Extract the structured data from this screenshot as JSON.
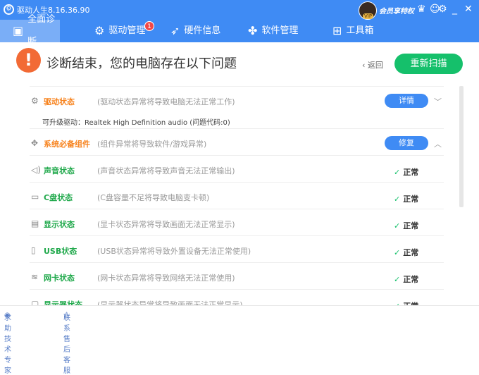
{
  "app": {
    "title": "驱动人生8.16.36.90",
    "member_label": "会员享特权",
    "vip_badge": "VIP"
  },
  "window_icons": [
    "crown-icon",
    "feedback-icon",
    "gear-icon",
    "minimize-icon",
    "close-icon"
  ],
  "tabs": [
    {
      "label": "全面诊断",
      "icon": "monitor-icon",
      "active": true
    },
    {
      "label": "驱动管理",
      "icon": "gear-icon",
      "badge": "1"
    },
    {
      "label": "硬件信息",
      "icon": "rocket-icon"
    },
    {
      "label": "软件管理",
      "icon": "clover-icon"
    },
    {
      "label": "工具箱",
      "icon": "toolbox-icon"
    }
  ],
  "header": {
    "title": "诊断结束，您的电脑存在以下问题",
    "back_label": "返回",
    "rescan_label": "重新扫描"
  },
  "colors": {
    "brand": "#3f8bf4",
    "warning": "#f26a35",
    "problem_text": "#f7831e",
    "ok_text": "#21a94c",
    "button_green": "#15c06b"
  },
  "rows": [
    {
      "name": "驱动状态",
      "desc": "(驱动状态异常将导致电脑无法正常工作)",
      "icon": "gear-icon",
      "status": "problem",
      "action": "详情",
      "expanded": false,
      "detail": "可升级驱动：Realtek High Definition audio (问题代码:0)"
    },
    {
      "name": "系统必备组件",
      "desc": "(组件异常将导致软件/游戏异常)",
      "icon": "puzzle-icon",
      "status": "problem",
      "action": "修复",
      "expanded": true
    },
    {
      "name": "声音状态",
      "desc": "(声音状态异常将导致声音无法正常输出)",
      "icon": "speaker-icon",
      "status": "正常"
    },
    {
      "name": "C盘状态",
      "desc": "(C盘容量不足将导致电脑变卡顿)",
      "icon": "disk-icon",
      "status": "正常"
    },
    {
      "name": "显示状态",
      "desc": "(显卡状态异常将导致画面无法正常显示)",
      "icon": "graphics-card-icon",
      "status": "正常"
    },
    {
      "name": "USB状态",
      "desc": "(USB状态异常将导致外置设备无法正常使用)",
      "icon": "usb-icon",
      "status": "正常"
    },
    {
      "name": "网卡状态",
      "desc": "(网卡状态异常将导致网络无法正常使用)",
      "icon": "wifi-icon",
      "status": "正常"
    },
    {
      "name": "显示器状态",
      "desc": "(显示器状态异常将导致画面无法正常显示)",
      "icon": "monitor-icon",
      "status": "正常"
    }
  ],
  "footer": {
    "expert": "求助技术专家",
    "service": "联系售后客服"
  }
}
